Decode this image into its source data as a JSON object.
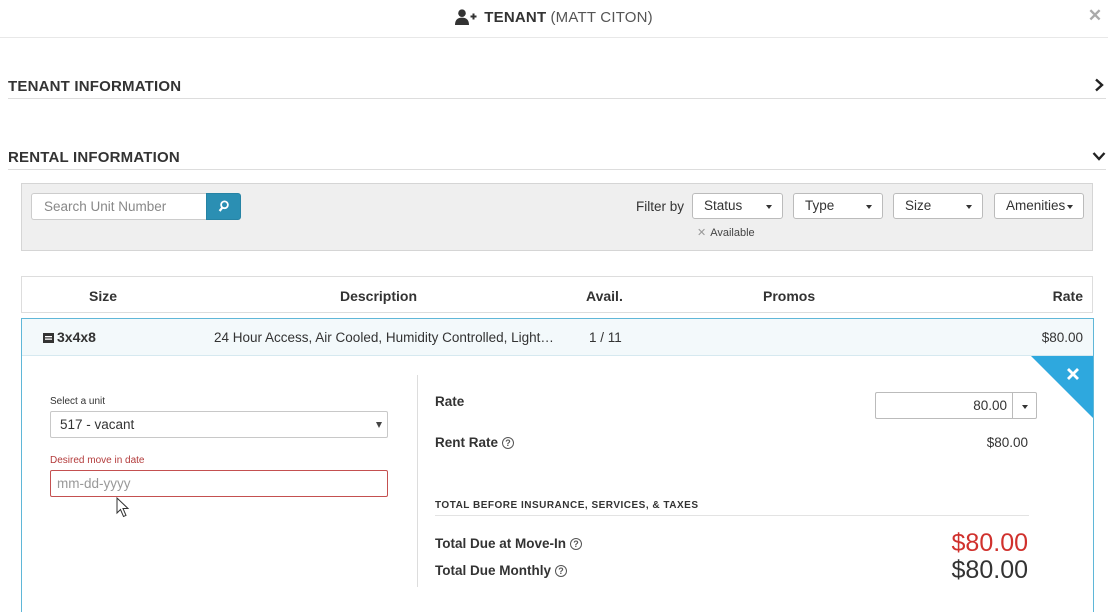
{
  "modal": {
    "title": "TENANT",
    "subtitle": "(MATT CITON)",
    "close_glyph": "✕",
    "icon": "user-plus-icon"
  },
  "sections": {
    "tenant_info": {
      "label": "TENANT INFORMATION",
      "state": "collapsed",
      "icon": "chevron-right-icon"
    },
    "rental_info": {
      "label": "RENTAL INFORMATION",
      "state": "expanded",
      "icon": "chevron-down-icon"
    }
  },
  "filters": {
    "search_placeholder": "Search Unit Number",
    "search_icon": "search-icon",
    "filter_by_label": "Filter by",
    "dropdowns": [
      "Status",
      "Type",
      "Size",
      "Amenities"
    ],
    "active_chip": {
      "remove_glyph": "✕",
      "label": "Available"
    }
  },
  "table": {
    "columns": [
      "Size",
      "Description",
      "Avail.",
      "Promos",
      "Rate"
    ],
    "rows": [
      {
        "size": "3x4x8",
        "description": "24 Hour Access, Air Cooled, Humidity Controlled, Light…",
        "avail": "1 / 11",
        "promos": "",
        "rate": "$80.00"
      }
    ]
  },
  "unit_form": {
    "select_label": "Select a unit",
    "select_value": "517 - vacant",
    "date_label": "Desired move in date",
    "date_placeholder": "mm-dd-yyyy",
    "rate_label": "Rate",
    "rate_value": "80.00",
    "rent_rate_label": "Rent Rate",
    "rent_rate_value": "$80.00",
    "help_glyph": "?",
    "totals_heading": "TOTAL BEFORE INSURANCE, SERVICES, & TAXES",
    "total_move_in_label": "Total Due at Move-In",
    "total_move_in_value": "$80.00",
    "total_monthly_label": "Total Due Monthly",
    "total_monthly_value": "$80.00"
  },
  "colors": {
    "accent_blue": "#2b8fb3",
    "corner_blue": "#2ea8de",
    "error_red": "#c45050",
    "move_in_red": "#d0312d",
    "card_border": "#5fb7d8"
  }
}
